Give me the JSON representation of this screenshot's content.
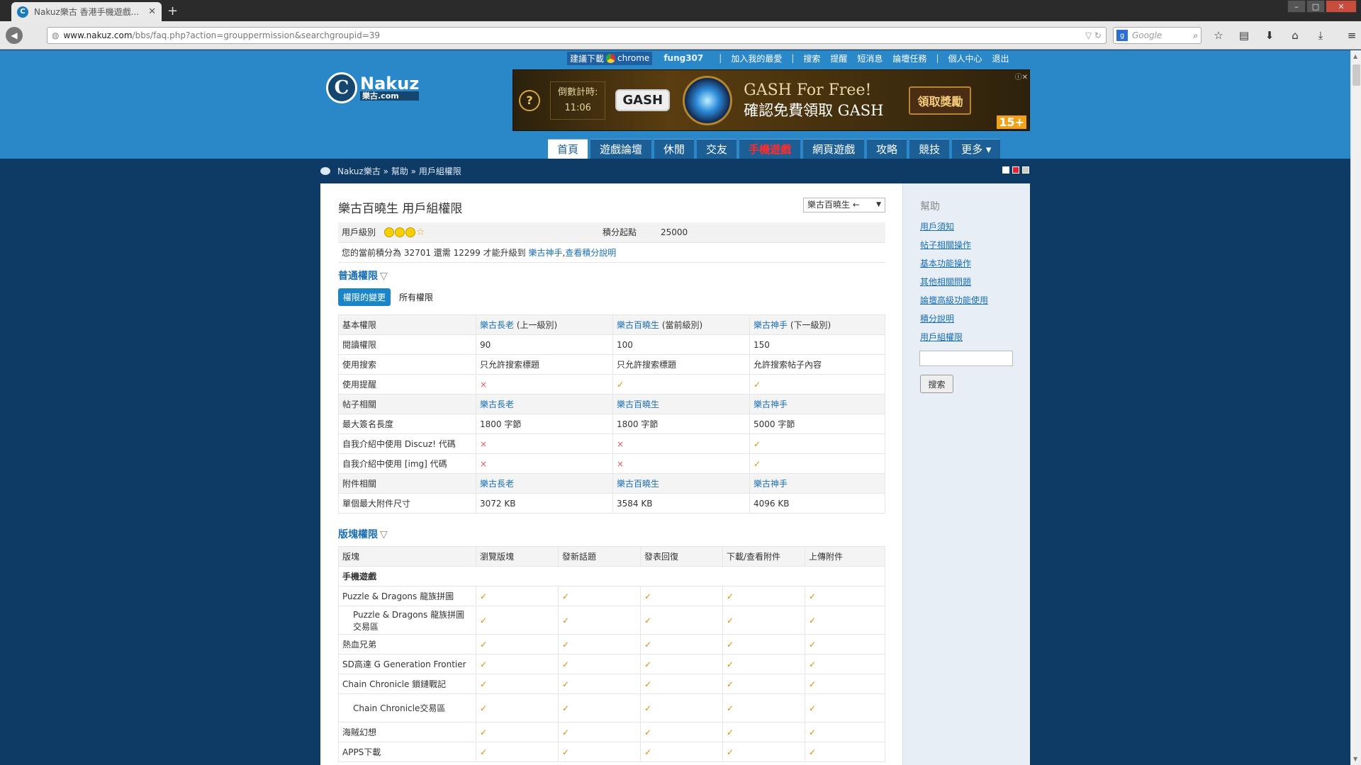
{
  "browser": {
    "tab_title": "Nakuz樂古 香港手機遊戲...",
    "new_tab": "+",
    "url_host": "www.nakuz.com",
    "url_path": "/bbs/faq.php?action=grouppermission&searchgroupid=39",
    "search_placeholder": "Google"
  },
  "topbar": {
    "download": "建議下載",
    "chrome": "chrome",
    "username": "fung307",
    "links": [
      "加入我的最愛",
      "搜索",
      "提醒",
      "短消息",
      "論壇任務",
      "個人中心",
      "退出"
    ]
  },
  "logo": {
    "letter": "C",
    "name": "Nakuz",
    "sub": "樂古.com"
  },
  "ad": {
    "timer_label": "倒數計時:",
    "timer_value": "11:06",
    "brand": "GASH",
    "line1": "GASH For Free!",
    "line2": "確認免費領取 GASH",
    "claim": "領取獎勵",
    "age": "15+"
  },
  "mainnav": [
    "首頁",
    "遊戲論壇",
    "休閒",
    "交友",
    "手機遊戲",
    "網頁遊戲",
    "攻略",
    "競技",
    "更多 ▾"
  ],
  "breadcrumb": [
    "Nakuz樂古",
    "»",
    "幫助",
    "»",
    "用戶組權限"
  ],
  "page_title": "樂古百曉生 用戶組權限",
  "group_select": "樂古百曉生 ←",
  "info": {
    "level_label": "用戶級別",
    "points_label": "積分起點",
    "points_value": "25000",
    "progress_prefix": "您的當前積分為 32701 還需 12299 才能升級到",
    "next_group": "樂古神手",
    "explain_link": "查看積分說明"
  },
  "general": {
    "title": "普通權限",
    "tab_changed": "權限的變更",
    "tab_all": "所有權限",
    "header": [
      "基本權限",
      "樂古長老",
      "(上一級別)",
      "樂古百曉生",
      "(當前級別)",
      "樂古神手",
      "(下一級別)"
    ],
    "rows": [
      {
        "label": "閱讀權限",
        "a": "90",
        "b": "100",
        "c": "150"
      },
      {
        "label": "使用搜索",
        "a": "只允許搜索標題",
        "b": "只允許搜索標題",
        "c": "允許搜索帖子內容"
      },
      {
        "label": "使用提醒",
        "a": "×",
        "b": "✓",
        "c": "✓"
      }
    ],
    "post_header": [
      "帖子相關",
      "樂古長老",
      "樂古百曉生",
      "樂古神手"
    ],
    "post_rows": [
      {
        "label": "最大簽名長度",
        "a": "1800 字節",
        "b": "1800 字節",
        "c": "5000 字節"
      },
      {
        "label": "自我介紹中使用 Discuz! 代碼",
        "a": "×",
        "b": "×",
        "c": "✓"
      },
      {
        "label": "自我介紹中使用 [img] 代碼",
        "a": "×",
        "b": "×",
        "c": "✓"
      }
    ],
    "attach_header": [
      "附件相關",
      "樂古長老",
      "樂古百曉生",
      "樂古神手"
    ],
    "attach_rows": [
      {
        "label": "單個最大附件尺寸",
        "a": "3072 KB",
        "b": "3584 KB",
        "c": "4096 KB"
      }
    ]
  },
  "forum": {
    "title": "版塊權限",
    "header": [
      "版塊",
      "瀏覽版塊",
      "發新話題",
      "發表回復",
      "下載/查看附件",
      "上傳附件"
    ],
    "category": "手機遊戲",
    "check": "✓",
    "rows": [
      {
        "label": "Puzzle & Dragons 龍族拼圖",
        "sub": false
      },
      {
        "label": "Puzzle & Dragons 龍族拼圖交易區",
        "sub": true
      },
      {
        "label": "熱血兄弟",
        "sub": false
      },
      {
        "label": "SD高達 G Generation Frontier",
        "sub": false
      },
      {
        "label": "Chain Chronicle 鎖鏈戰記",
        "sub": false
      },
      {
        "label": "Chain Chronicle交易區",
        "sub": true
      },
      {
        "label": "海賊幻想",
        "sub": false
      },
      {
        "label": "APPS下載",
        "sub": false
      }
    ]
  },
  "sidebar": {
    "title": "幫助",
    "links": [
      "用戶須知",
      "帖子相關操作",
      "基本功能操作",
      "其他相關問題",
      "論壇高級功能使用",
      "積分說明",
      "用戶組權限"
    ],
    "search_button": "搜索"
  }
}
